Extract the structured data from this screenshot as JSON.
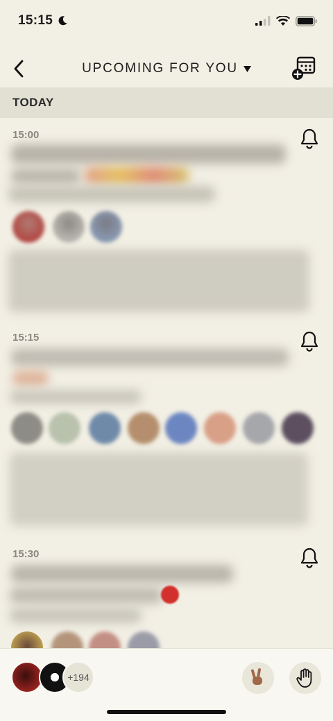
{
  "status_bar": {
    "time": "15:15"
  },
  "nav": {
    "title": "UPCOMING FOR YOU"
  },
  "section": {
    "label": "TODAY"
  },
  "events": [
    {
      "time": "15:00"
    },
    {
      "time": "15:15"
    },
    {
      "time": "15:30"
    }
  ],
  "bottom_bar": {
    "more_count": "+194"
  },
  "colors": {
    "background": "#f2efe4",
    "section_header": "#e1e0d3",
    "time_text": "#8a8680",
    "bottom_bar": "#f8f7f1"
  }
}
